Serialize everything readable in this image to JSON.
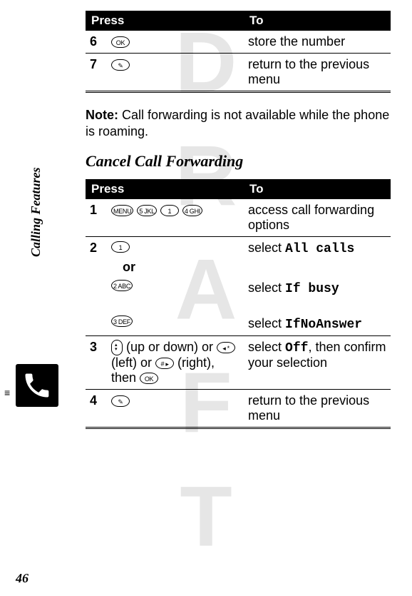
{
  "watermark": "DRAFT",
  "sidebar_label": "Calling Features",
  "page_number": "46",
  "table1": {
    "head_press": "Press",
    "head_to": "To",
    "rows": [
      {
        "step": "6",
        "to": "store the number"
      },
      {
        "step": "7",
        "to": "return to the previous menu"
      }
    ]
  },
  "note": {
    "label": "Note:",
    "text": " Call forwarding is not available while the phone is roaming."
  },
  "section_heading": "Cancel Call Forwarding",
  "table2": {
    "head_press": "Press",
    "head_to": "To",
    "row1": {
      "step": "1",
      "to": "access call forwarding options",
      "k1": "MENU",
      "k2": "5 JKL",
      "k3": "1",
      "k4": "4 GHI"
    },
    "row2": {
      "step": "2",
      "k_top": "1",
      "or": "or",
      "k_mid": "2 ABC",
      "k_bot": "3 DEF",
      "to_top_a": "select ",
      "to_top_b": "All calls",
      "to_mid_a": "select ",
      "to_mid_b": "If busy",
      "to_bot_a": "select ",
      "to_bot_b": "IfNoAnswer"
    },
    "row3": {
      "step": "3",
      "press_a": " (up or down) or ",
      "k_left": "◂ *",
      "press_b": " (left) or ",
      "k_right": "# ▸",
      "press_c": " (right), then ",
      "k_ok": "OK",
      "to_a": "select ",
      "to_b": "Off",
      "to_c": ", then confirm your selection"
    },
    "row4": {
      "step": "4",
      "to": "return to the previous menu"
    },
    "end_key_label": "✎"
  }
}
